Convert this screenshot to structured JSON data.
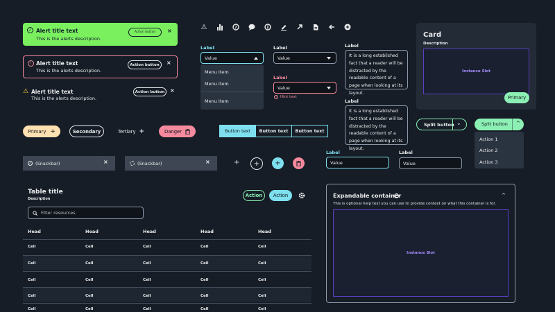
{
  "alerts": {
    "success": {
      "title": "Alert title text",
      "desc": "This is the alerts description.",
      "button": "Action button"
    },
    "error": {
      "title": "Alert title text",
      "desc": "This is the alerts description.",
      "button": "Action button"
    },
    "warning": {
      "title": "Alert title text",
      "desc": "This is the alerts description.",
      "button": "Action button"
    }
  },
  "icons": [
    "warning-icon",
    "bar-chart-icon",
    "help-icon",
    "comment-icon",
    "info-icon",
    "edit-icon",
    "external-arrow-icon",
    "file-icon",
    "arrow-left-icon",
    "add-circle-icon"
  ],
  "select_open": {
    "label": "Label",
    "value": "Value",
    "menu": [
      "Menu Item",
      "Menu Item",
      "Menu Item"
    ]
  },
  "select_plain": {
    "label": "Label",
    "value": "Value"
  },
  "select_error": {
    "label": "Label",
    "value": "Value",
    "hint": "Hint text"
  },
  "textarea1": {
    "label": "Label",
    "value": "It is a long established fact that a reader will be distracted by the readable content of a page when looking at its layout."
  },
  "textarea2": {
    "label": "Label",
    "value": "It is a long established fact that a reader will be distracted by the readable content of a page when looking at its layout."
  },
  "card": {
    "title": "Card",
    "desc": "Description",
    "slot": "Instance Slot",
    "button": "Primary"
  },
  "buttons": {
    "primary": "Primary",
    "secondary": "Secondary",
    "tertiary": "Tertiary",
    "danger": "Danger"
  },
  "segmented": [
    "Button text",
    "Button text",
    "Button text"
  ],
  "split1": {
    "label": "Split button"
  },
  "split2": {
    "label": "Split button",
    "actions": [
      "Action 1",
      "Action 2",
      "Action 3"
    ]
  },
  "snackbars": [
    "(Snackbar)",
    "(Snackbar)"
  ],
  "input_focus": {
    "label": "Label",
    "value": "Value"
  },
  "input_plain": {
    "label": "Label",
    "value": "Value"
  },
  "table": {
    "title": "Table title",
    "desc": "Description",
    "action1": "Action",
    "action2": "Action",
    "filter_placeholder": "Filter resources",
    "headers": [
      "Head",
      "Head",
      "Head",
      "Head",
      "Head"
    ],
    "rows": [
      [
        "Cell",
        "Cell",
        "Cell",
        "Cell",
        "Cell"
      ],
      [
        "Cell",
        "Cell",
        "Cell",
        "Cell",
        "Cell"
      ],
      [
        "Cell",
        "Cell",
        "Cell",
        "Cell",
        "Cell"
      ],
      [
        "Cell",
        "Cell",
        "Cell",
        "Cell",
        "Cell"
      ],
      [
        "Cell",
        "Cell",
        "Cell",
        "Cell",
        "Cell"
      ]
    ]
  },
  "expandable": {
    "title": "Expandable container",
    "help": "This is optional help text you can use to provide context on what this container is for.",
    "slot": "Instance Slot"
  },
  "colors": {
    "bg": "#161d26",
    "success": "#7bf05f",
    "error": "#f58a9e",
    "accent": "#7ee0ef",
    "primary": "#ffe0b0",
    "split": "#8cf0b4"
  }
}
